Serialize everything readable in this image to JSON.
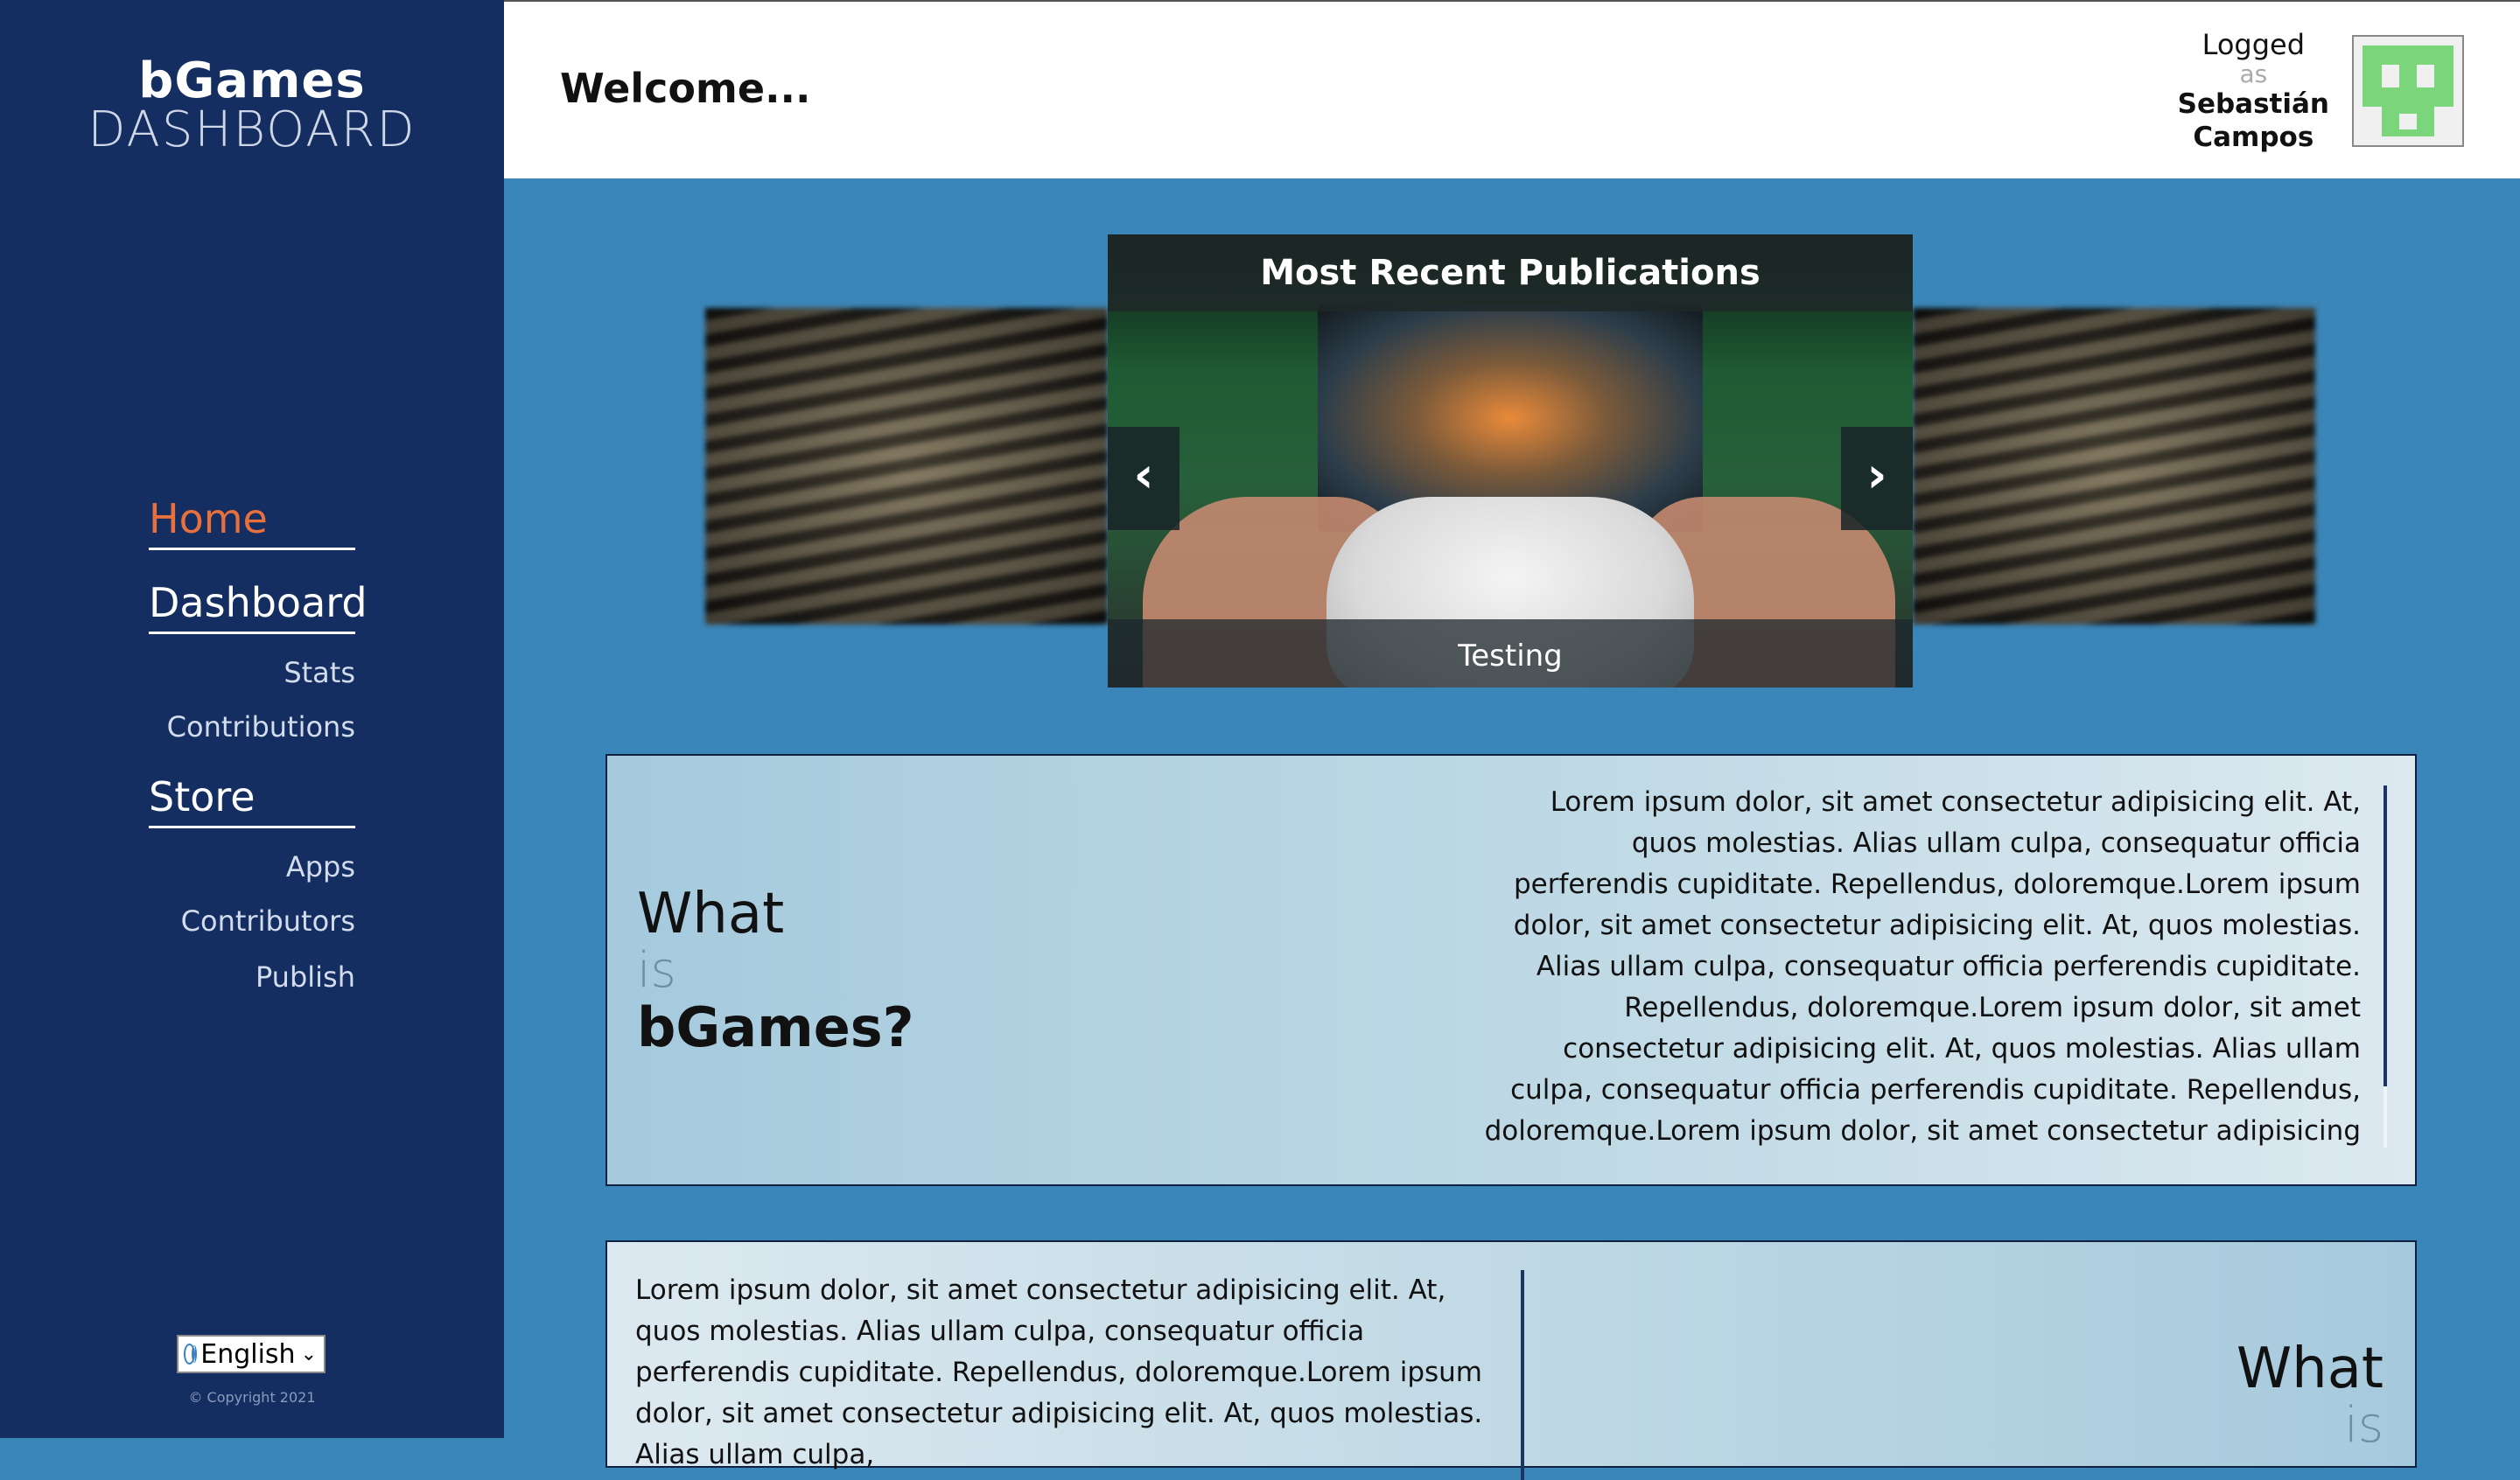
{
  "sidebar": {
    "brand_top": "bGames",
    "brand_bottom": "DASHBOARD",
    "nav": {
      "home": "Home",
      "dashboard": "Dashboard",
      "stats": "Stats",
      "contributions": "Contributions",
      "store": "Store",
      "apps": "Apps",
      "contributors": "Contributors",
      "publish": "Publish"
    },
    "language": "English",
    "copyright": "© Copyright 2021"
  },
  "header": {
    "welcome": "Welcome...",
    "logged": "Logged",
    "as": "as",
    "user_first": "Sebastián",
    "user_last": "Campos"
  },
  "carousel": {
    "title": "Most Recent Publications",
    "caption": "Testing",
    "prev": "‹",
    "next": "›"
  },
  "cards": {
    "what": "What",
    "is": "is",
    "bgames": "bGames?",
    "lorem1": "Lorem ipsum dolor, sit amet consectetur adipisicing elit. At, quos molestias. Alias ullam culpa, consequatur officia perferendis cupiditate. Repellendus, doloremque.Lorem ipsum dolor, sit amet consectetur adipisicing elit. At, quos molestias. Alias ullam culpa, consequatur officia perferendis cupiditate. Repellendus, doloremque.Lorem ipsum dolor, sit amet consectetur adipisicing elit. At, quos molestias. Alias ullam culpa, consequatur officia perferendis cupiditate. Repellendus, doloremque.Lorem ipsum dolor, sit amet consectetur adipisicing",
    "lorem2": "Lorem ipsum dolor, sit amet consectetur adipisicing elit. At, quos molestias. Alias ullam culpa, consequatur officia perferendis cupiditate. Repellendus, doloremque.Lorem ipsum dolor, sit amet consectetur adipisicing elit. At, quos molestias. Alias ullam culpa,"
  },
  "colors": {
    "sidebar_bg": "#142e62",
    "active_nav": "#e8703d",
    "main_bg": "#3b86b8",
    "avatar_green": "#7bd67b"
  }
}
